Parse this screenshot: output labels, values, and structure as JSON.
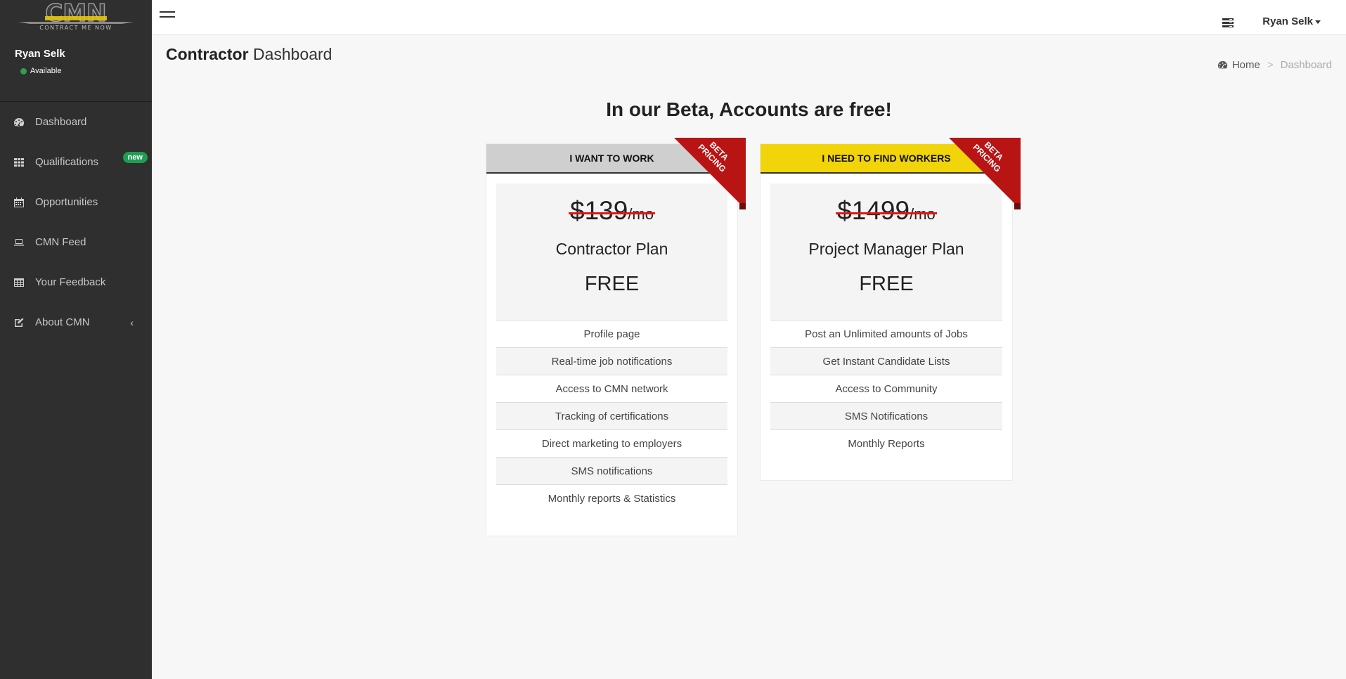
{
  "sidebar": {
    "logo_text": "CMN",
    "logo_tagline": "CONTRACT ME NOW",
    "user_name": "Ryan Selk",
    "user_status": "Available",
    "items": [
      {
        "label": "Dashboard",
        "icon": "dashboard-icon"
      },
      {
        "label": "Qualifications",
        "icon": "grid-icon",
        "badge": "new"
      },
      {
        "label": "Opportunities",
        "icon": "calendar-icon"
      },
      {
        "label": "CMN Feed",
        "icon": "laptop-icon"
      },
      {
        "label": "Your Feedback",
        "icon": "table-icon"
      },
      {
        "label": "About CMN",
        "icon": "edit-icon"
      }
    ]
  },
  "header": {
    "user_name": "Ryan Selk"
  },
  "page": {
    "title_bold": "Contractor",
    "title_light": "Dashboard",
    "breadcrumb": [
      "Home",
      ">",
      "Dashboard"
    ],
    "headline": "In our Beta, Accounts are free!"
  },
  "plans": [
    {
      "header": "I WANT TO WORK",
      "ribbon": [
        "BETA",
        "PRICING"
      ],
      "price": "$139",
      "per": "/mo",
      "name": "Contractor Plan",
      "free": "FREE",
      "features": [
        "Profile page",
        "Real-time job notifications",
        "Access to CMN network",
        "Tracking of certifications",
        "Direct marketing to employers",
        "SMS notifications",
        "Monthly reports & Statistics"
      ]
    },
    {
      "header": "I NEED TO FIND WORKERS",
      "ribbon": [
        "BETA",
        "PRICING"
      ],
      "price": "$1499",
      "per": "/mo",
      "name": "Project Manager Plan",
      "free": "FREE",
      "features": [
        "Post an Unlimited amounts of Jobs",
        "Get Instant Candidate Lists",
        "Access to Community",
        "SMS Notifications",
        "Monthly Reports"
      ]
    }
  ],
  "colors": {
    "sidebar_bg": "#2f2f2f",
    "accent_yellow": "#f2d40a",
    "ribbon_red": "#b81414",
    "badge_green": "#1f9d55",
    "strike_red": "#e01515"
  }
}
